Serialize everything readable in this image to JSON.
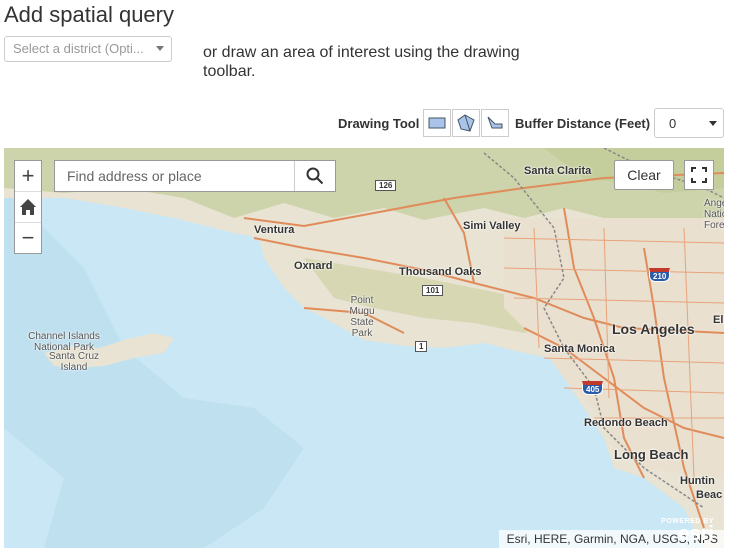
{
  "header": {
    "title": "Add spatial query"
  },
  "district_select": {
    "value": "Select a district (Opti..."
  },
  "instructions": "or draw an area of interest using the drawing toolbar.",
  "toolbar": {
    "drawing_tool_label": "Drawing Tool",
    "buffer_label": "Buffer Distance (Feet)",
    "buffer_value": "0",
    "tools": [
      {
        "name": "rectangle-icon"
      },
      {
        "name": "polygon-icon"
      },
      {
        "name": "freehand-icon"
      }
    ]
  },
  "map": {
    "zoom_in": "+",
    "zoom_out": "−",
    "search_placeholder": "Find address or place",
    "clear_label": "Clear",
    "attribution": "Esri, HERE, Garmin, NGA, USGS, NPS",
    "logo_small": "POWERED BY",
    "logo_text": "esri",
    "colors": {
      "ocean": "#c9e7f4",
      "land": "#e8e3d3",
      "road": "#e08c5a"
    },
    "labels": {
      "santa_clarita": "Santa Clarita",
      "simi_valley": "Simi Valley",
      "ventura": "Ventura",
      "oxnard": "Oxnard",
      "thousand_oaks": "Thousand Oaks",
      "point_mugu": "Point Mugu State Park",
      "channel_islands": "Channel Islands National Park",
      "santa_cruz": "Santa Cruz Island",
      "los_angeles": "Los Angeles",
      "santa_monica": "Santa Monica",
      "redondo": "Redondo Beach",
      "long_beach": "Long Beach",
      "huntington": "Huntin",
      "huntington2": "Beac",
      "el": "El",
      "angeles_forest": "Ange Natio Fore"
    },
    "shields": {
      "s126": "126",
      "s210": "210",
      "s101": "101",
      "s1": "1",
      "s405": "405"
    }
  }
}
